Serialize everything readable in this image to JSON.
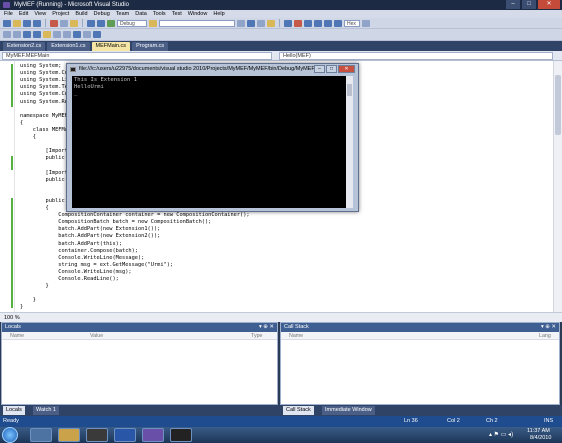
{
  "window": {
    "title": "MyMEF (Running) - Microsoft Visual Studio"
  },
  "menu": [
    "File",
    "Edit",
    "View",
    "Project",
    "Build",
    "Debug",
    "Team",
    "Data",
    "Tools",
    "Test",
    "Window",
    "Help"
  ],
  "toolbar": {
    "config": "Debug",
    "hex_label": "Hex"
  },
  "tabs": [
    {
      "label": "Extension2.cs"
    },
    {
      "label": "Extension1.cs"
    },
    {
      "label": "MEFMain.cs",
      "active": true
    },
    {
      "label": "Program.cs"
    }
  ],
  "nav": {
    "left": "MyMEF.MEFMain",
    "right": "Hello(MEF)"
  },
  "code_lines": [
    {
      "l": "using System;"
    },
    {
      "l": "using System.Co"
    },
    {
      "l": "using System.Li"
    },
    {
      "l": "using System.Te"
    },
    {
      "l": "using System.Co"
    },
    {
      "l": "using System.Re"
    },
    {
      "l": ""
    },
    {
      "l": "namespace MyMEF"
    },
    {
      "l": "{"
    },
    {
      "l": "    class MEFMa"
    },
    {
      "l": "    {"
    },
    {
      "l": ""
    },
    {
      "l": "        [Import"
    },
    {
      "l": "        public "
    },
    {
      "l": ""
    },
    {
      "l": "        [Import"
    },
    {
      "l": "        public "
    },
    {
      "l": ""
    },
    {
      "l": ""
    },
    {
      "l": "        public "
    },
    {
      "l": "        {"
    },
    {
      "l": "            CompositionContainer container = new CompositionContainer();"
    },
    {
      "l": "            CompositionBatch batch = new CompositionBatch();"
    },
    {
      "l": "            batch.AddPart(new Extension1());"
    },
    {
      "l": "            batch.AddPart(new Extension2());"
    },
    {
      "l": "            batch.AddPart(this);"
    },
    {
      "l": "            container.Compose(batch);"
    },
    {
      "l": "            Console.WriteLine(Message);"
    },
    {
      "l": "            string msg = ext.GetMessage(\"Urmi\");"
    },
    {
      "l": "            Console.WriteLine(msg);"
    },
    {
      "l": "            Console.ReadLine();"
    },
    {
      "l": "        }"
    },
    {
      "l": ""
    },
    {
      "l": "    }"
    },
    {
      "l": "}"
    }
  ],
  "zoom": "100 %",
  "console": {
    "title": "file:///c:/users/u22975/documents/visual studio 2010/Projects/MyMEF/MyMEF/bin/Debug/MyMEF...",
    "lines": [
      "This Is Extension 1",
      "HelloUrmi",
      "_"
    ]
  },
  "locals": {
    "title": "Locals",
    "cols": [
      "Name",
      "Value",
      "Type"
    ]
  },
  "callstack": {
    "title": "Call Stack",
    "cols": [
      "Name",
      "Lang"
    ]
  },
  "bottom_tabs": {
    "left": [
      "Locals",
      "Watch 1"
    ],
    "right": [
      "Call Stack",
      "Immediate Window"
    ]
  },
  "status": {
    "ready": "Ready",
    "ln": "Ln 36",
    "col": "Col 2",
    "ch": "Ch 2",
    "ins": "INS"
  },
  "clock": {
    "time": "11:37 AM",
    "date": "8/4/2010"
  }
}
